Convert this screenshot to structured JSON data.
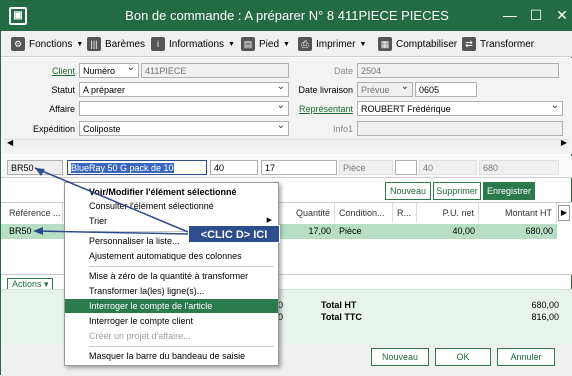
{
  "window": {
    "title": "Bon de commande : A préparer N° 8 411PIECE PIECES",
    "app_icon": "ps-icon"
  },
  "toolbar": {
    "fonctions": "Fonctions",
    "baremes": "Barèmes",
    "informations": "Informations",
    "pied": "Pied",
    "imprimer": "Imprimer",
    "comptabiliser": "Comptabiliser",
    "transformer": "Transformer"
  },
  "form": {
    "client_label": "Client",
    "client_type": "Numéro",
    "client_value": "411PIECE",
    "date_label": "Date",
    "date_value": "2504",
    "statut_label": "Statut",
    "statut_value": "A préparer",
    "date_livraison_label": "Date livraison",
    "date_livraison_type": "Prévue",
    "date_livraison_value": "0605",
    "affaire_label": "Affaire",
    "affaire_value": "",
    "representant_label": "Représentant",
    "representant_value": "ROUBERT Frédérique",
    "expedition_label": "Expédition",
    "expedition_value": "Coliposte",
    "info1_label": "Info1",
    "info1_value": ""
  },
  "entry": {
    "ref": "BR50",
    "designation": "BlueRay 50 G pack de 10",
    "qty1": "40",
    "qty2": "17",
    "unit": "Pièce",
    "val1": "",
    "val2": "40",
    "val3": "680"
  },
  "actions": {
    "nouveau": "Nouveau",
    "supprimer": "Supprimer",
    "enregistrer": "Enregistrer"
  },
  "grid": {
    "headers": [
      "Référence ...",
      "Quantité",
      "Condition...",
      "R...",
      "P.U. net",
      "Montant HT"
    ],
    "row": {
      "ref": "BR50",
      "quantite": "17,00",
      "condition": "Pièce",
      "pu": "40,00",
      "montant": "680,00"
    }
  },
  "footer": {
    "actions_label": "Actions",
    "total_ht_label": "Total HT",
    "total_ht_value": "680,00",
    "total_ttc_label": "Total TTC",
    "total_ttc_value": "816,00",
    "left_val1": "00",
    "left_val2": "00"
  },
  "menu": {
    "items": [
      "Voir/Modifier l'élément sélectionné",
      "Consulter l'élément sélectionné",
      "Trier",
      "Personnaliser la liste...",
      "Ajustement automatique des colonnes",
      "Mise à zéro de la quantité à transformer",
      "Transformer la(les) ligne(s)...",
      "Interroger le compte de l'article",
      "Interroger le compte client",
      "Créer un projet d'affaire...",
      "Masquer la barre du bandeau de saisie"
    ]
  },
  "callout": "<CLIC D> ICI",
  "bottom": {
    "nouveau": "Nouveau",
    "ok": "OK",
    "annuler": "Annuler"
  },
  "colors": {
    "accent": "#236b43",
    "highlight": "#2a7a4b",
    "row_selected": "#b9dec6",
    "callout": "#2e4d8c"
  }
}
